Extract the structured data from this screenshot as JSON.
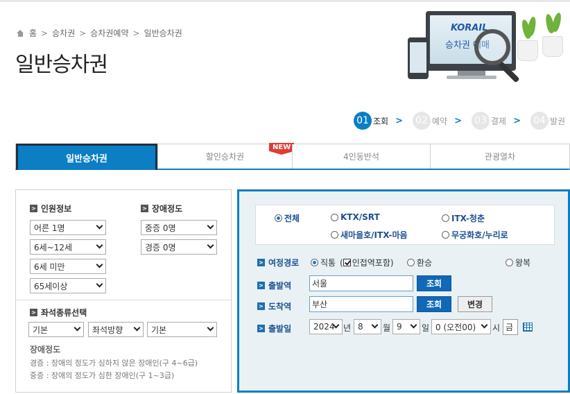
{
  "breadcrumb": [
    "홈",
    "승차권",
    "승차권예약",
    "일반승차권"
  ],
  "page_title": "일반승차권",
  "hero": {
    "logo": "KORAIL",
    "label": "승차권 예매"
  },
  "steps": [
    {
      "num": "01",
      "label": "조회"
    },
    {
      "num": "02",
      "label": "예약"
    },
    {
      "num": "03",
      "label": "결제"
    },
    {
      "num": "04",
      "label": "발권"
    }
  ],
  "tabs": [
    "일반승차권",
    "할인승차권",
    "4인동반석",
    "관광열차"
  ],
  "new_badge": "NEW",
  "left": {
    "passenger_title": "인원정보",
    "disability_title": "장애정도",
    "passengers": [
      "어른 1명",
      "6세~12세",
      "6세 미만",
      "65세이상"
    ],
    "disability": [
      "중증 0명",
      "경증 0명"
    ],
    "seat_title": "좌석종류선택",
    "seat_selects": [
      "기본",
      "좌석방향",
      "기본"
    ],
    "note_title": "장애정도",
    "notes": [
      "경증 : 장애의 정도가 심하지 않은 장애인(구 4~6급)",
      "중증 : 장애의 정도가 심한 장애인(구 1~3급)"
    ]
  },
  "train_types": [
    "전체",
    "KTX/SRT",
    "ITX-청춘",
    "새마을호/ITX-마음",
    "무궁화호/누리로"
  ],
  "route": {
    "label": "여정경로",
    "direct": "직통",
    "direct_paren": "(",
    "nearby": "인접역포함)",
    "transfer": "환승",
    "roundtrip": "왕복"
  },
  "departure": {
    "label": "출발역",
    "value": "서울",
    "button": "조회"
  },
  "arrival": {
    "label": "도착역",
    "value": "부산",
    "button": "조회",
    "swap": "변경"
  },
  "date": {
    "label": "출발일",
    "year": "2024",
    "year_unit": "년",
    "month": "8",
    "month_unit": "월",
    "day": "9",
    "day_unit": "일",
    "hour": "0 (오전00)",
    "hour_unit": "시",
    "weekday": "금"
  }
}
